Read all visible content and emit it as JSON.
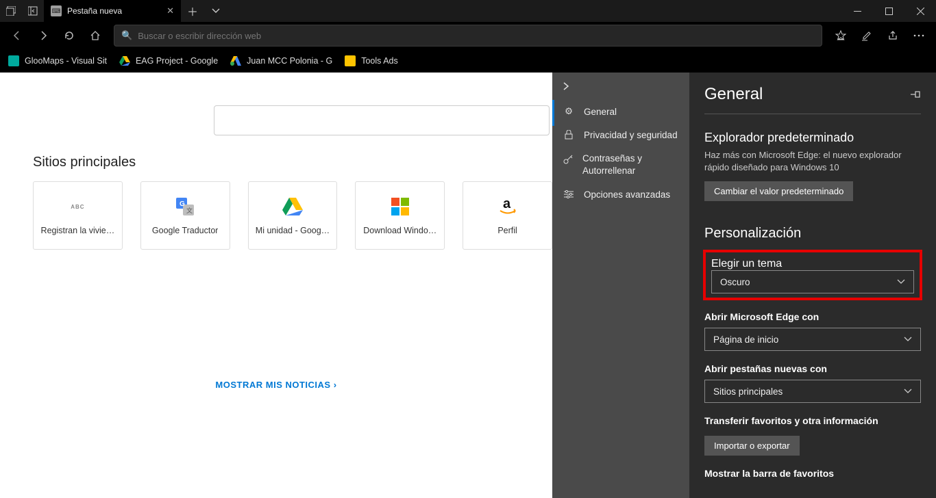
{
  "tab": {
    "title": "Pestaña nueva"
  },
  "addressbar": {
    "placeholder": "Buscar o escribir dirección web"
  },
  "bookmarks": [
    {
      "label": "GlooMaps - Visual Sit",
      "color": "#00a99d",
      "glyph": ""
    },
    {
      "label": "EAG Project - Google",
      "color": "transparent",
      "glyph": "drive"
    },
    {
      "label": "Juan MCC Polonia - G",
      "color": "transparent",
      "glyph": "ads"
    },
    {
      "label": "Tools Ads",
      "color": "#ffc400",
      "glyph": ""
    }
  ],
  "newtab": {
    "top_sites_title": "Sitios principales",
    "tiles": [
      {
        "label": "Registran la vivie…",
        "icon": "ABC",
        "style": "text-gray"
      },
      {
        "label": "Google Traductor",
        "icon": "Gt",
        "style": "gtrans"
      },
      {
        "label": "Mi unidad - Goog…",
        "icon": "drive",
        "style": "drive"
      },
      {
        "label": "Download Windo…",
        "icon": "ms",
        "style": "ms"
      },
      {
        "label": "Perfil",
        "icon": "a",
        "style": "amazon"
      }
    ],
    "show_news": "MOSTRAR MIS NOTICIAS"
  },
  "settings_nav": {
    "items": [
      {
        "label": "General",
        "icon": "gear"
      },
      {
        "label": "Privacidad y seguridad",
        "icon": "lock"
      },
      {
        "label": "Contraseñas y Autorrellenar",
        "icon": "key"
      },
      {
        "label": "Opciones avanzadas",
        "icon": "sliders"
      }
    ]
  },
  "panel": {
    "title": "General",
    "default_browser": {
      "heading": "Explorador predeterminado",
      "desc": "Haz más con Microsoft Edge: el nuevo explorador rápido diseñado para Windows 10",
      "button": "Cambiar el valor predeterminado"
    },
    "personalization": "Personalización",
    "theme": {
      "label": "Elegir un tema",
      "value": "Oscuro"
    },
    "open_with": {
      "label": "Abrir Microsoft Edge con",
      "value": "Página de inicio"
    },
    "new_tabs": {
      "label": "Abrir pestañas nuevas con",
      "value": "Sitios principales"
    },
    "transfer": {
      "label": "Transferir favoritos y otra información",
      "button": "Importar o exportar"
    },
    "favbar": {
      "label": "Mostrar la barra de favoritos"
    }
  }
}
